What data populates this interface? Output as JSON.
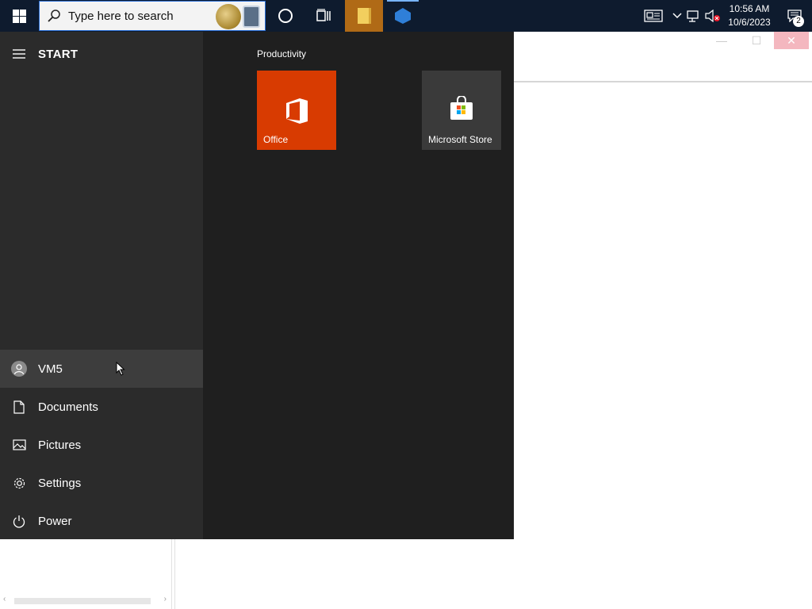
{
  "taskbar": {
    "search": {
      "placeholder": "Type here to search",
      "icon": "search-icon"
    },
    "clock": {
      "time": "10:56 AM",
      "date": "10/6/2023"
    },
    "notifications": {
      "count": "2"
    },
    "colors": {
      "bar": "#0e1b2e",
      "search_border": "#2b6fd6",
      "active_app": "#b06a16"
    }
  },
  "start_menu": {
    "title": "START",
    "group_label": "Productivity",
    "tiles": [
      {
        "label": "Office",
        "color": "#d83b01",
        "icon": "office-icon"
      },
      {
        "label": "Microsoft Store",
        "color": "#3a3a3a",
        "icon": "store-bag-icon"
      }
    ],
    "nav": [
      {
        "label": "VM5",
        "icon": "user-avatar-icon"
      },
      {
        "label": "Documents",
        "icon": "document-icon"
      },
      {
        "label": "Pictures",
        "icon": "pictures-icon"
      },
      {
        "label": "Settings",
        "icon": "gear-icon"
      },
      {
        "label": "Power",
        "icon": "power-icon"
      }
    ]
  },
  "background_window": {
    "controls": {
      "minimize": "—",
      "maximize": "☐",
      "close": "✕"
    }
  }
}
